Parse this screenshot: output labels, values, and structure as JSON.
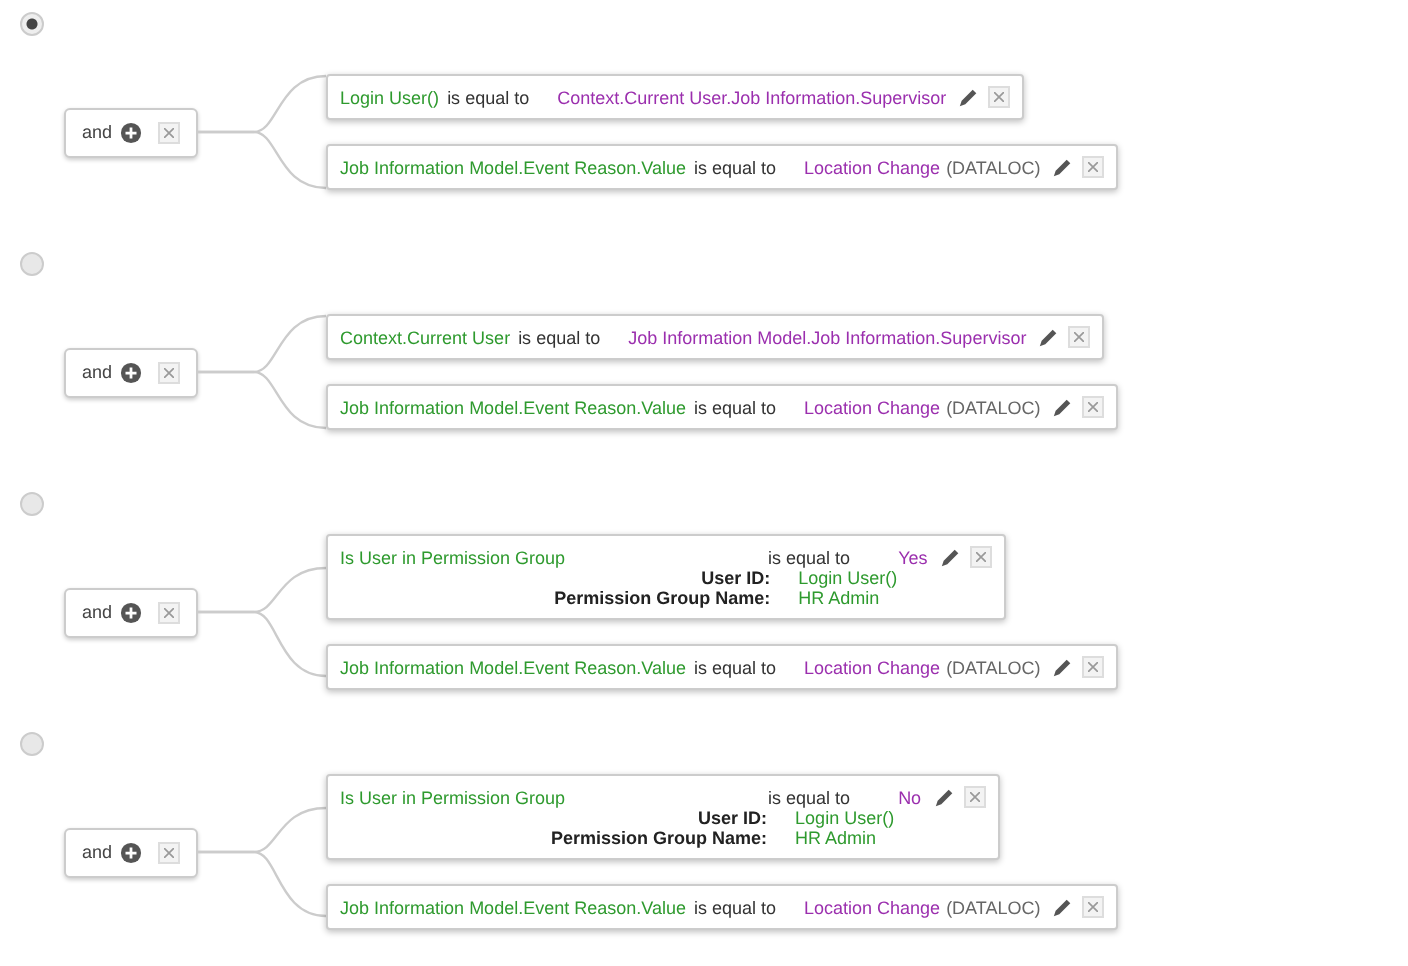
{
  "rule_options": [
    {
      "selected": true,
      "operator": "and",
      "conditions": [
        {
          "left": "Login User()",
          "op": "is equal to",
          "right": "Context.Current User.Job Information.Supervisor"
        },
        {
          "left": "Job Information Model.Event Reason.Value",
          "op": "is equal to",
          "right": "Location Change",
          "suffix": "(DATALOC)"
        }
      ]
    },
    {
      "selected": false,
      "operator": "and",
      "conditions": [
        {
          "left": "Context.Current User",
          "op": "is equal to",
          "right": "Job Information Model.Job Information.Supervisor"
        },
        {
          "left": "Job Information Model.Event Reason.Value",
          "op": "is equal to",
          "right": "Location Change",
          "suffix": "(DATALOC)"
        }
      ]
    },
    {
      "selected": false,
      "operator": "and",
      "conditions": [
        {
          "left": "Is User in Permission Group",
          "op": "is equal to",
          "right": "Yes",
          "params": [
            {
              "label": "User ID:",
              "value": "Login User()"
            },
            {
              "label": "Permission Group Name:",
              "value": "HR Admin"
            }
          ]
        },
        {
          "left": "Job Information Model.Event Reason.Value",
          "op": "is equal to",
          "right": "Location Change",
          "suffix": "(DATALOC)"
        }
      ]
    },
    {
      "selected": false,
      "operator": "and",
      "conditions": [
        {
          "left": "Is User in Permission Group",
          "op": "is equal to",
          "right": "No",
          "params": [
            {
              "label": "User ID:",
              "value": "Login User()"
            },
            {
              "label": "Permission Group Name:",
              "value": "HR Admin"
            }
          ]
        },
        {
          "left": "Job Information Model.Event Reason.Value",
          "op": "is equal to",
          "right": "Location Change",
          "suffix": "(DATALOC)"
        }
      ]
    }
  ]
}
